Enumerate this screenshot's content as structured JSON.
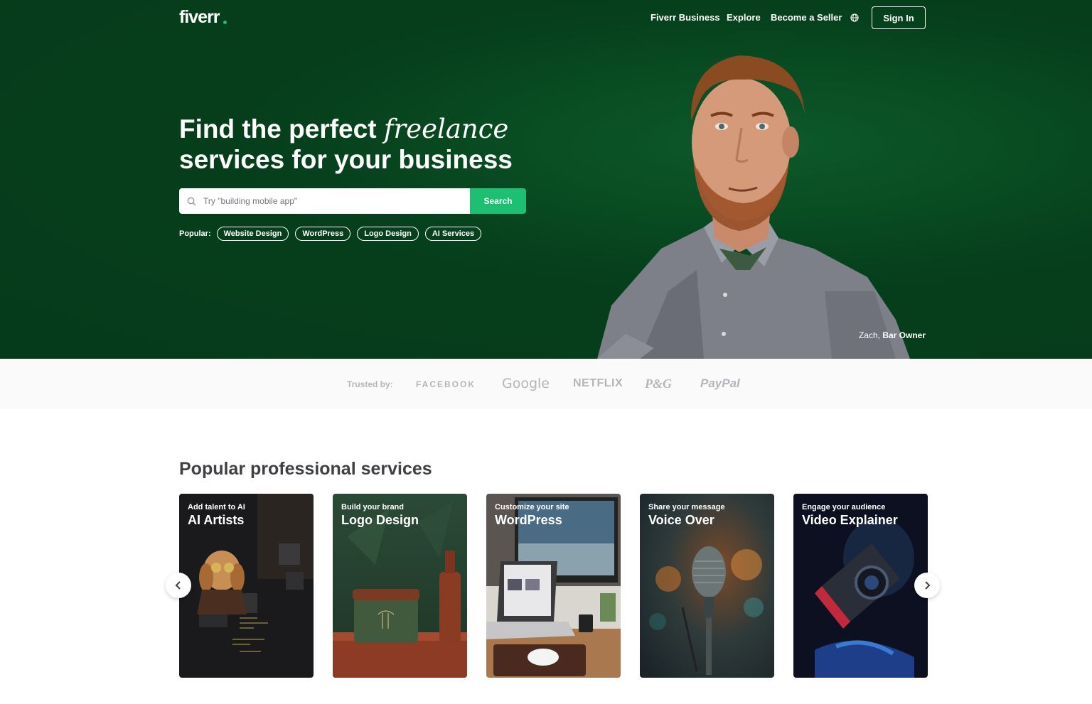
{
  "header": {
    "logo": "fiverr",
    "nav": [
      "Fiverr Business",
      "Explore",
      "Become a Seller"
    ],
    "globe_icon": "globe-icon",
    "signin_label": "Sign In"
  },
  "hero": {
    "headline_part1": "Find the perfect ",
    "headline_italic": "freelance",
    "headline_part2": "services for your business",
    "search_placeholder": "Try \"building mobile app\"",
    "search_button": "Search",
    "popular_label": "Popular:",
    "popular_tags": [
      "Website Design",
      "WordPress",
      "Logo Design",
      "AI Services"
    ],
    "caption_name": "Zach, ",
    "caption_role": "Bar Owner"
  },
  "trusted": {
    "label": "Trusted by:",
    "brands": [
      "FACEBOOK",
      "Google",
      "NETFLIX",
      "P&G",
      "PayPal"
    ]
  },
  "services": {
    "title": "Popular professional services",
    "cards": [
      {
        "sub": "Add talent to AI",
        "title": "AI Artists"
      },
      {
        "sub": "Build your brand",
        "title": "Logo Design"
      },
      {
        "sub": "Customize your site",
        "title": "WordPress"
      },
      {
        "sub": "Share your message",
        "title": "Voice Over"
      },
      {
        "sub": "Engage your audience",
        "title": "Video Explainer"
      }
    ],
    "prev_icon": "chevron-left-icon",
    "next_icon": "chevron-right-icon"
  },
  "colors": {
    "hero_green": "#063f1c",
    "accent": "#1dbf73",
    "text_dark": "#404145",
    "muted": "#b5b6ba"
  }
}
